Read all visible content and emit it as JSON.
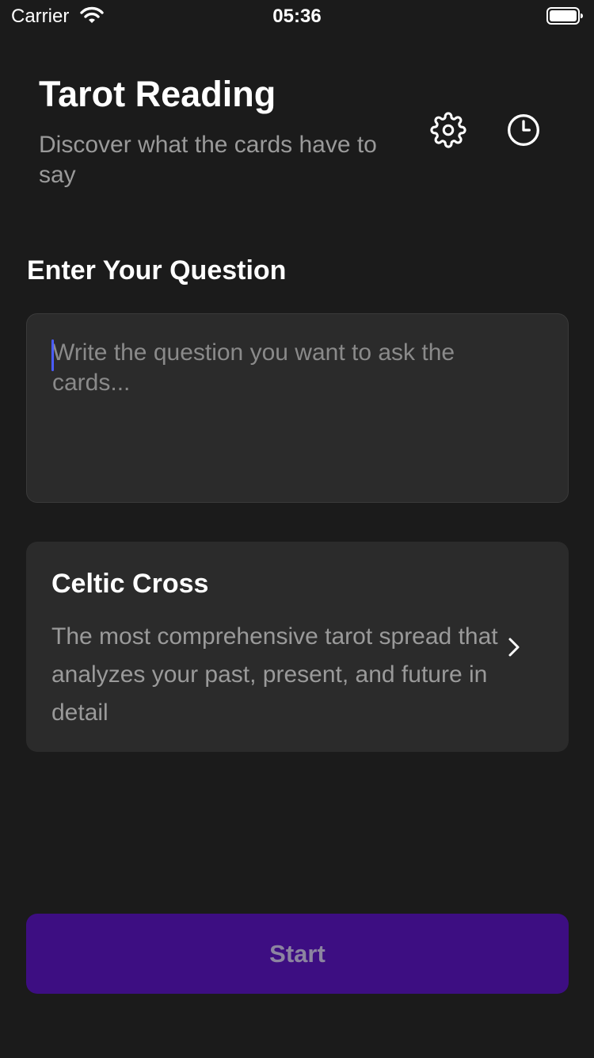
{
  "status_bar": {
    "carrier": "Carrier",
    "time": "05:36",
    "wifi_icon": "wifi-icon",
    "battery_icon": "battery-icon"
  },
  "header": {
    "title": "Tarot Reading",
    "subtitle": "Discover what the cards have to say",
    "settings_icon": "gear-icon",
    "history_icon": "clock-icon"
  },
  "question": {
    "section_title": "Enter Your Question",
    "value": "",
    "placeholder": "Write the question you want to ask the cards..."
  },
  "spread": {
    "name": "Celtic Cross",
    "description": "The most comprehensive tarot spread that analyzes your past, present, and future in detail",
    "chevron_icon": "chevron-right-icon"
  },
  "actions": {
    "start_label": "Start"
  },
  "colors": {
    "background": "#1b1b1b",
    "card": "#2b2b2b",
    "accent": "#3d0e82",
    "caret": "#4a5cff"
  }
}
